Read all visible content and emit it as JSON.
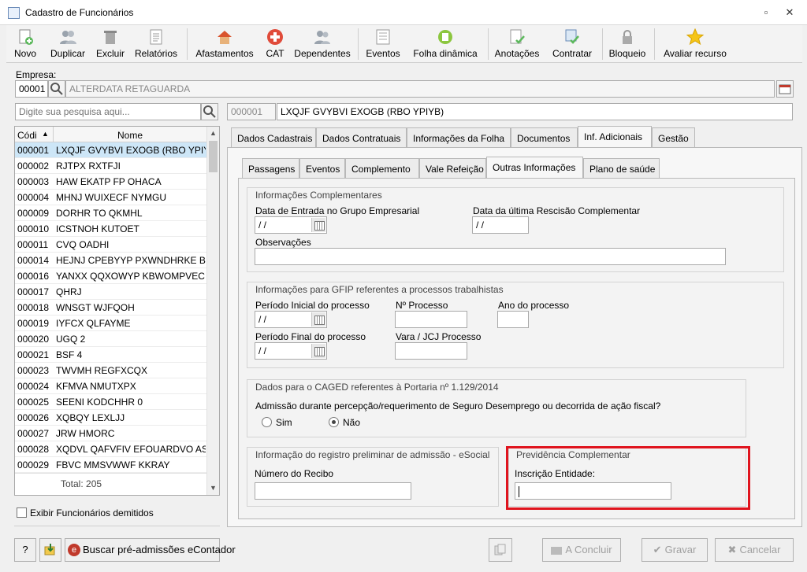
{
  "window": {
    "title": "Cadastro de Funcionários"
  },
  "toolbar": {
    "items": [
      {
        "label": "Novo"
      },
      {
        "label": "Duplicar"
      },
      {
        "label": "Excluir"
      },
      {
        "label": "Relatórios"
      },
      {
        "label": "Afastamentos"
      },
      {
        "label": "CAT"
      },
      {
        "label": "Dependentes"
      },
      {
        "label": "Eventos"
      },
      {
        "label": "Folha dinâmica"
      },
      {
        "label": "Anotações"
      },
      {
        "label": "Contratar"
      },
      {
        "label": "Bloqueio"
      },
      {
        "label": "Avaliar recurso"
      }
    ]
  },
  "empresa": {
    "label": "Empresa:",
    "code": "00001",
    "name": "ALTERDATA RETAGUARDA"
  },
  "search": {
    "placeholder": "Digite sua pesquisa aqui..."
  },
  "selected": {
    "code": "000001",
    "name": "LXQJF GVYBVI EXOGB (RBO YPIYB)"
  },
  "list": {
    "col_code": "Códi",
    "col_name": "Nome",
    "rows": [
      {
        "code": "000001",
        "name": "LXQJF GVYBVI EXOGB (RBO YPIYB)"
      },
      {
        "code": "000002",
        "name": "RJTPX RXTFJI"
      },
      {
        "code": "000003",
        "name": "HAW EKATP FP OHACA"
      },
      {
        "code": "000004",
        "name": "MHNJ WUIXECF NYMGU"
      },
      {
        "code": "000009",
        "name": "DORHR TO QKMHL"
      },
      {
        "code": "000010",
        "name": "ICSTNOH KUTOET"
      },
      {
        "code": "000011",
        "name": "CVQ OADHI"
      },
      {
        "code": "000014",
        "name": "HEJNJ CPEBYYP PXWNDHRKE BTB J"
      },
      {
        "code": "000016",
        "name": "YANXX QQXOWYP KBWOMPVEC A"
      },
      {
        "code": "000017",
        "name": "QHRJ"
      },
      {
        "code": "000018",
        "name": "WNSGT WJFQOH"
      },
      {
        "code": "000019",
        "name": "IYFCX QLFAYME"
      },
      {
        "code": "000020",
        "name": "UGQ 2"
      },
      {
        "code": "000021",
        "name": "BSF 4"
      },
      {
        "code": "000023",
        "name": "TWVMH REGFXCQX"
      },
      {
        "code": "000024",
        "name": "KFMVA NMUTXPX"
      },
      {
        "code": "000025",
        "name": "SEENI KODCHHR 0"
      },
      {
        "code": "000026",
        "name": "XQBQY LEXLJJ"
      },
      {
        "code": "000027",
        "name": "JRW HMORC"
      },
      {
        "code": "000028",
        "name": "XQDVL QAFVFIV EFOUARDVO AST U"
      },
      {
        "code": "000029",
        "name": "FBVC MMSVWWF KKRAY"
      }
    ],
    "total": "Total: 205"
  },
  "show_dismissed": {
    "label": "Exibir Funcionários demitidos"
  },
  "tabs": [
    "Dados Cadastrais",
    "Dados Contratuais",
    "Informações da Folha",
    "Documentos",
    "Inf. Adicionais",
    "Gestão"
  ],
  "subtabs": [
    "Passagens",
    "Eventos",
    "Complemento",
    "Vale Refeição",
    "Outras Informações",
    "Plano de saúde"
  ],
  "info_comp": {
    "title": "Informações Complementares",
    "entry_date_label": "Data de Entrada no Grupo Empresarial",
    "entry_date_value": " / /",
    "rescisao_label": "Data da última Rescisão Complementar",
    "rescisao_value": " / /",
    "obs_label": "Observações"
  },
  "gfip": {
    "title": "Informações para GFIP referentes a processos trabalhistas",
    "start_label": "Período Inicial do processo",
    "start_value": " / /",
    "nprocesso_label": "Nº Processo",
    "ano_label": "Ano do processo",
    "end_label": "Período Final do processo",
    "end_value": " / /",
    "vara_label": "Vara / JCJ Processo"
  },
  "caged": {
    "title": "Dados para o CAGED referentes à Portaria nº 1.129/2014",
    "question": "Admissão durante percepção/requerimento de Seguro Desemprego ou decorrida de ação fiscal?",
    "opt_sim": "Sim",
    "opt_nao": "Não",
    "selected": "Não"
  },
  "esocial": {
    "title": "Informação do registro preliminar de admissão - eSocial",
    "recibo_label": "Número do Recibo"
  },
  "previdencia": {
    "title": "Previdência Complementar",
    "inscricao_label": "Inscrição Entidade:"
  },
  "bottom": {
    "help": "?",
    "buscar": "Buscar pré-admissões eContador",
    "concluir": "A Concluir",
    "gravar": "Gravar",
    "cancelar": "Cancelar"
  },
  "colors": {
    "highlight": "#e0141e",
    "selection": "#cde6f7"
  }
}
